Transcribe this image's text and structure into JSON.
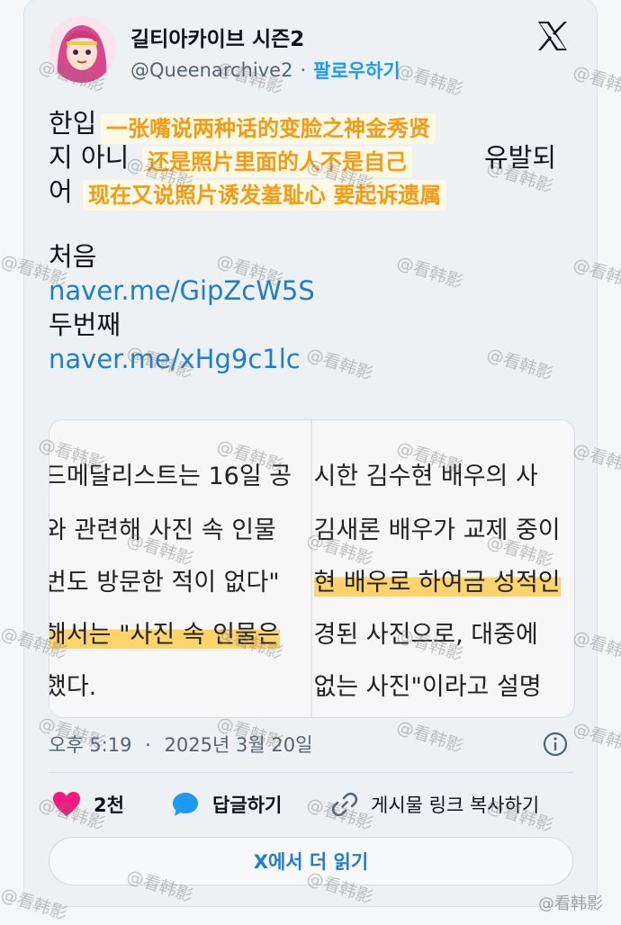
{
  "author": {
    "display_name": "길티아카이브 시즌2",
    "handle": "@Queenarchive2",
    "separator": "·",
    "follow_label": "팔로우하기"
  },
  "tweet": {
    "lines": [
      "한입",
      "지 아니",
      "어",
      "처음",
      "naver.me/GipZcW5S",
      "두번째",
      "naver.me/xHg9c1lc"
    ],
    "line3_tail": "유발되"
  },
  "overlay_cn": [
    "一张嘴说两种话的变脸之神金秀贤",
    "还是照片里面的人不是自己",
    "现在又说照片诱发羞耻心 要起诉遗属"
  ],
  "media": {
    "left_lines": [
      "드메달리스트는 16일 공",
      "와 관련해 사진 속 인물",
      "번도 방문한 적이 없다\"",
      "해서는 \"사진 속 인물은",
      "했다."
    ],
    "right_lines": [
      "시한 김수현 배우의 사",
      "김새론 배우가 교제 중이",
      "현 배우로 하여금 성적인",
      "경된 사진으로, 대중에",
      "없는 사진\"이라고 설명"
    ]
  },
  "meta": {
    "time": "오후 5:19",
    "separator": "·",
    "date": "2025년 3월 20일"
  },
  "actions": {
    "like_count": "2천",
    "reply_label": "답글하기",
    "copy_link_label": "게시물 링크 복사하기"
  },
  "read_more_label": "X에서 더 읽기",
  "watermark": {
    "text": "@看韩影",
    "corner_text": "@看韩影"
  },
  "colors": {
    "link": "#1d7fc9",
    "follow": "#1d9bf0",
    "overlay_text": "#f39c12",
    "highlight": "#fdc83c",
    "heart": "#f91880"
  }
}
